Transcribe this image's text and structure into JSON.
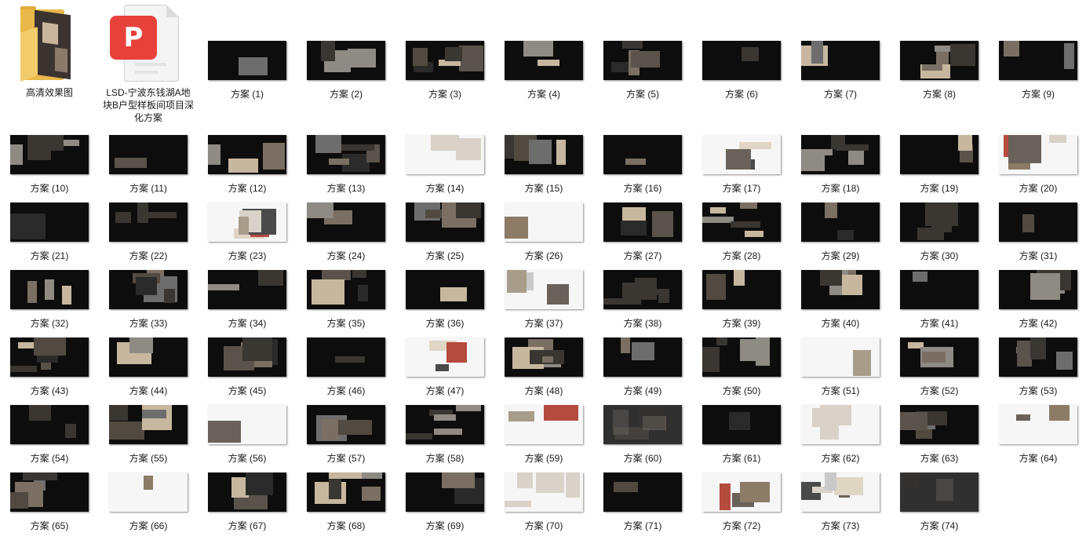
{
  "folder": {
    "label": "高清效果图",
    "icon": "folder-icon"
  },
  "pdf_file": {
    "label": "LSD-宁波东钱湖A地块B户型样板间项目深化方案",
    "icon": "pdf-icon",
    "accent": "#e8413c"
  },
  "files": [
    {
      "label": "方案 (1)",
      "theme": "dark"
    },
    {
      "label": "方案 (2)",
      "theme": "dark"
    },
    {
      "label": "方案 (3)",
      "theme": "dark"
    },
    {
      "label": "方案 (4)",
      "theme": "dark"
    },
    {
      "label": "方案 (5)",
      "theme": "dark"
    },
    {
      "label": "方案 (6)",
      "theme": "dark"
    },
    {
      "label": "方案 (7)",
      "theme": "dark"
    },
    {
      "label": "方案 (8)",
      "theme": "dark"
    },
    {
      "label": "方案 (9)",
      "theme": "dark"
    },
    {
      "label": "方案 (10)",
      "theme": "dark"
    },
    {
      "label": "方案 (11)",
      "theme": "dark"
    },
    {
      "label": "方案 (12)",
      "theme": "dark"
    },
    {
      "label": "方案 (13)",
      "theme": "dark"
    },
    {
      "label": "方案 (14)",
      "theme": "light"
    },
    {
      "label": "方案 (15)",
      "theme": "dark"
    },
    {
      "label": "方案 (16)",
      "theme": "dark"
    },
    {
      "label": "方案 (17)",
      "theme": "light"
    },
    {
      "label": "方案 (18)",
      "theme": "dark"
    },
    {
      "label": "方案 (19)",
      "theme": "dark"
    },
    {
      "label": "方案 (20)",
      "theme": "light"
    },
    {
      "label": "方案 (21)",
      "theme": "dark"
    },
    {
      "label": "方案 (22)",
      "theme": "dark"
    },
    {
      "label": "方案 (23)",
      "theme": "light"
    },
    {
      "label": "方案 (24)",
      "theme": "dark"
    },
    {
      "label": "方案 (25)",
      "theme": "dark"
    },
    {
      "label": "方案 (26)",
      "theme": "light"
    },
    {
      "label": "方案 (27)",
      "theme": "dark"
    },
    {
      "label": "方案 (28)",
      "theme": "dark"
    },
    {
      "label": "方案 (29)",
      "theme": "dark"
    },
    {
      "label": "方案 (30)",
      "theme": "dark"
    },
    {
      "label": "方案 (31)",
      "theme": "dark"
    },
    {
      "label": "方案 (32)",
      "theme": "dark"
    },
    {
      "label": "方案 (33)",
      "theme": "dark"
    },
    {
      "label": "方案 (34)",
      "theme": "dark"
    },
    {
      "label": "方案 (35)",
      "theme": "dark"
    },
    {
      "label": "方案 (36)",
      "theme": "dark"
    },
    {
      "label": "方案 (37)",
      "theme": "light"
    },
    {
      "label": "方案 (38)",
      "theme": "dark"
    },
    {
      "label": "方案 (39)",
      "theme": "dark"
    },
    {
      "label": "方案 (40)",
      "theme": "dark"
    },
    {
      "label": "方案 (41)",
      "theme": "dark"
    },
    {
      "label": "方案 (42)",
      "theme": "dark"
    },
    {
      "label": "方案 (43)",
      "theme": "dark"
    },
    {
      "label": "方案 (44)",
      "theme": "dark"
    },
    {
      "label": "方案 (45)",
      "theme": "dark"
    },
    {
      "label": "方案 (46)",
      "theme": "dark"
    },
    {
      "label": "方案 (47)",
      "theme": "light"
    },
    {
      "label": "方案 (48)",
      "theme": "dark"
    },
    {
      "label": "方案 (49)",
      "theme": "dark"
    },
    {
      "label": "方案 (50)",
      "theme": "dark"
    },
    {
      "label": "方案 (51)",
      "theme": "light"
    },
    {
      "label": "方案 (52)",
      "theme": "dark"
    },
    {
      "label": "方案 (53)",
      "theme": "dark"
    },
    {
      "label": "方案 (54)",
      "theme": "dark"
    },
    {
      "label": "方案 (55)",
      "theme": "dark"
    },
    {
      "label": "方案 (56)",
      "theme": "light"
    },
    {
      "label": "方案 (57)",
      "theme": "dark"
    },
    {
      "label": "方案 (58)",
      "theme": "dark"
    },
    {
      "label": "方案 (59)",
      "theme": "light"
    },
    {
      "label": "方案 (60)",
      "theme": "gray"
    },
    {
      "label": "方案 (61)",
      "theme": "dark"
    },
    {
      "label": "方案 (62)",
      "theme": "light"
    },
    {
      "label": "方案 (63)",
      "theme": "dark"
    },
    {
      "label": "方案 (64)",
      "theme": "light"
    },
    {
      "label": "方案 (65)",
      "theme": "dark"
    },
    {
      "label": "方案 (66)",
      "theme": "light"
    },
    {
      "label": "方案 (67)",
      "theme": "dark"
    },
    {
      "label": "方案 (68)",
      "theme": "dark"
    },
    {
      "label": "方案 (69)",
      "theme": "dark"
    },
    {
      "label": "方案 (70)",
      "theme": "light"
    },
    {
      "label": "方案 (71)",
      "theme": "dark"
    },
    {
      "label": "方案 (72)",
      "theme": "light"
    },
    {
      "label": "方案 (73)",
      "theme": "light"
    },
    {
      "label": "方案 (74)",
      "theme": "gray"
    }
  ]
}
